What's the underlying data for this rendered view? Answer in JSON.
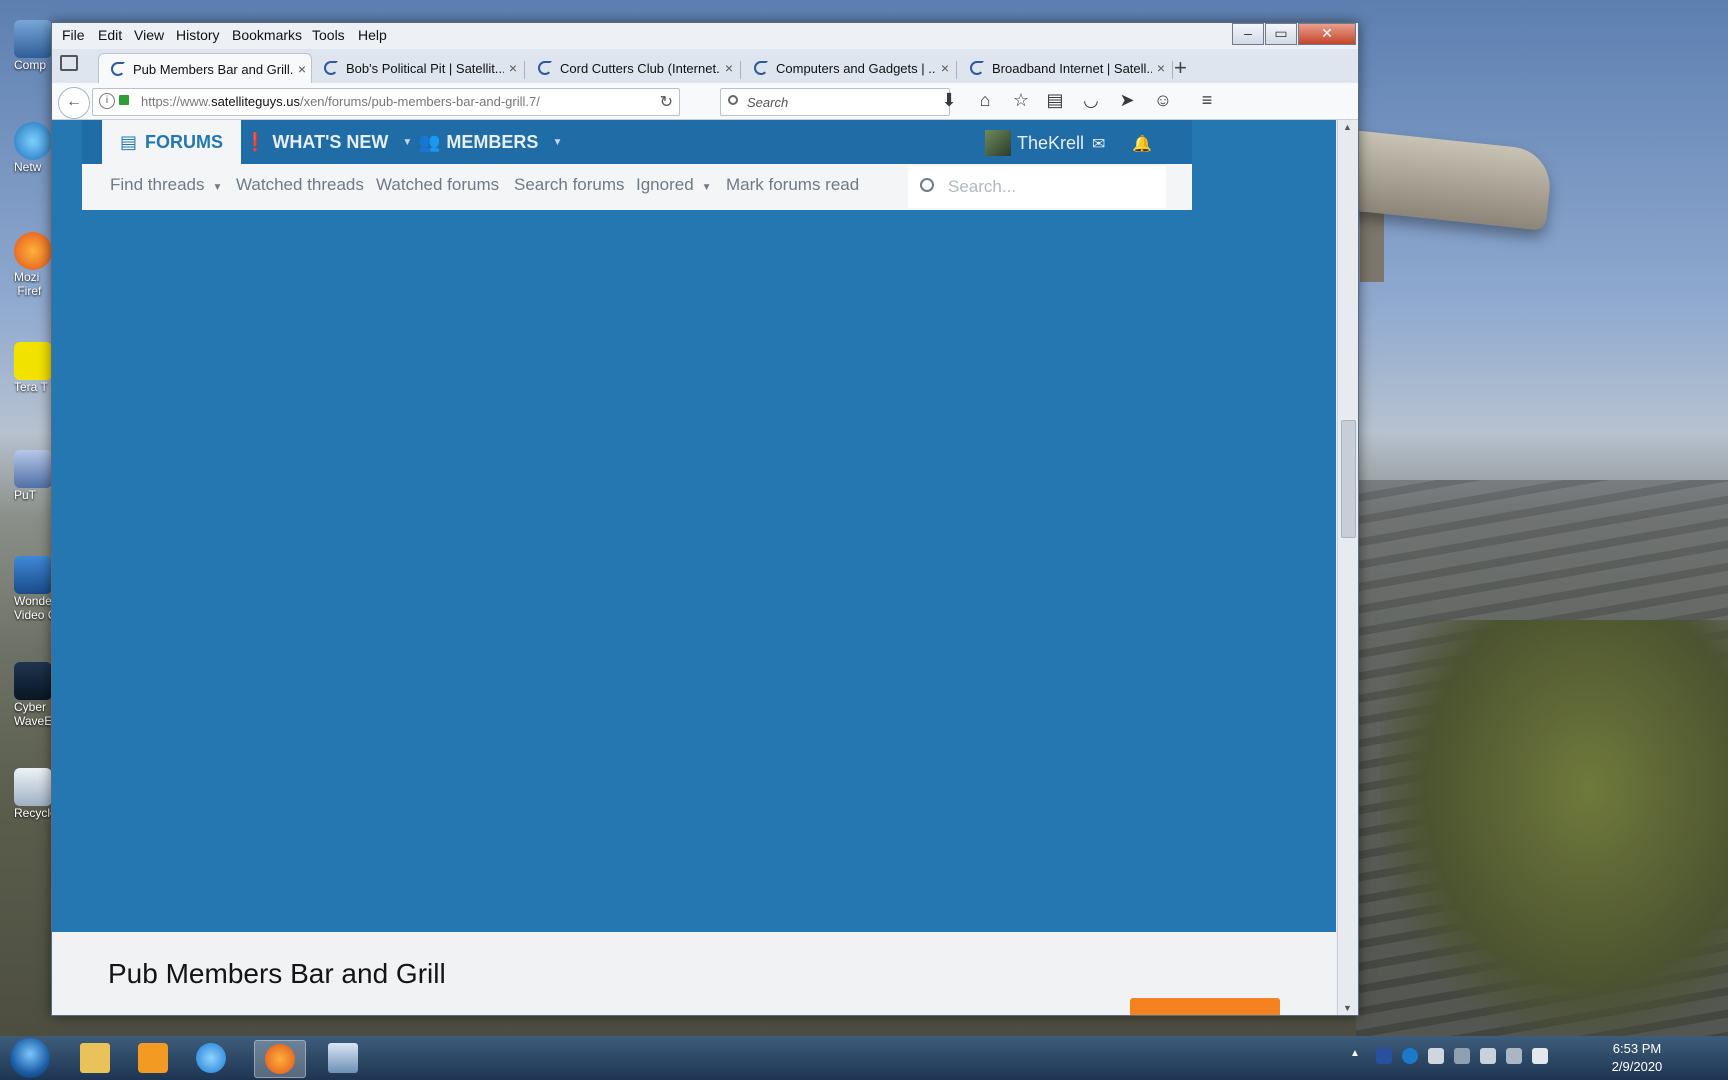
{
  "desktop": {
    "icons": [
      {
        "label": "Comp"
      },
      {
        "label": "Netw"
      },
      {
        "label": "Mozi\n Firef"
      },
      {
        "label": "Tera T"
      },
      {
        "label": "PuT"
      },
      {
        "label": "Wonder\nVideo C"
      },
      {
        "label": "Cyber\nWaveE"
      },
      {
        "label": "Recycle"
      }
    ]
  },
  "menubar": {
    "items": [
      "File",
      "Edit",
      "View",
      "History",
      "Bookmarks",
      "Tools",
      "Help"
    ]
  },
  "tabs": [
    {
      "title": "Pub Members Bar and Grill..."
    },
    {
      "title": "Bob's Political Pit | Satellit..."
    },
    {
      "title": "Cord Cutters Club (Internet..."
    },
    {
      "title": "Computers and Gadgets | ..."
    },
    {
      "title": "Broadband Internet | Satell..."
    }
  ],
  "navbar": {
    "url_prefix": "https://www.",
    "url_domain": "satelliteguys.us",
    "url_path": "/xen/forums/pub-members-bar-and-grill.7/",
    "search_placeholder": "Search"
  },
  "site": {
    "nav": {
      "forums": "FORUMS",
      "whats_new": "WHAT'S NEW",
      "members": "MEMBERS",
      "username": "TheKrell"
    },
    "subnav": [
      "Find threads",
      "Watched threads",
      "Watched forums",
      "Search forums",
      "Ignored",
      "Mark forums read"
    ],
    "search_placeholder": "Search...",
    "page_title": "Pub Members Bar and Grill"
  },
  "taskbar": {
    "time": "6:53 PM",
    "date": "2/9/2020"
  },
  "colors": {
    "site_blue": "#2577b1",
    "nav_blue": "#1f6ca6",
    "accent_orange": "#f58220"
  }
}
